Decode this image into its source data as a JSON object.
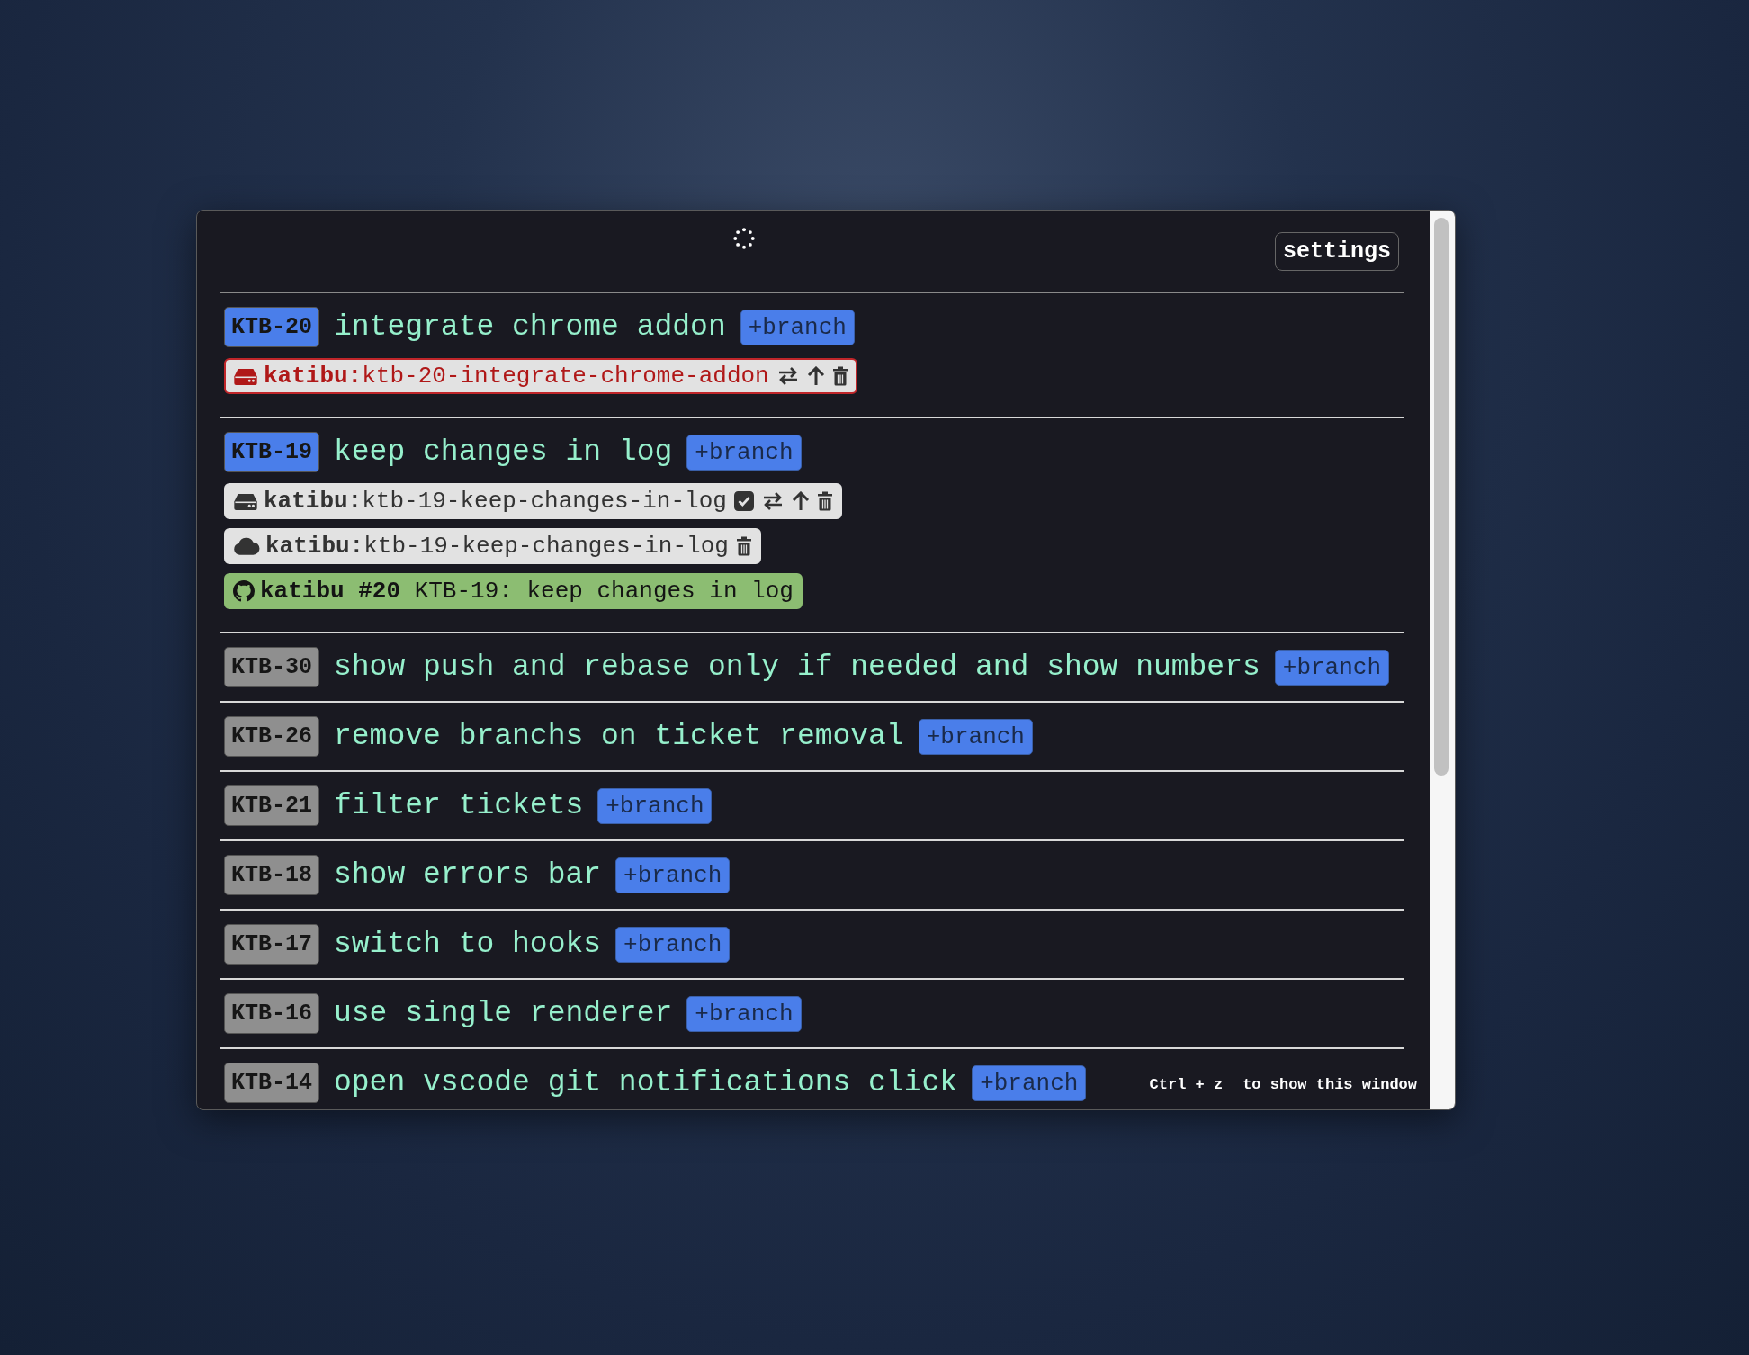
{
  "header": {
    "settings_button": "settings"
  },
  "tickets": [
    {
      "key": "KTB-20",
      "highlighted": true,
      "title": "integrate chrome addon",
      "add_branch": "+branch",
      "branches": [
        {
          "kind": "local",
          "error": true,
          "label": "**katibu:**ktb-20-integrate-chrome-addon",
          "actions": [
            {
              "kind": "switch"
            },
            {
              "kind": "push"
            },
            {
              "kind": "delete"
            }
          ]
        }
      ]
    },
    {
      "key": "KTB-19",
      "highlighted": true,
      "title": "keep changes in log",
      "add_branch": "+branch",
      "branches": [
        {
          "kind": "local",
          "error": false,
          "label": "**katibu:**ktb-19-keep-changes-in-log",
          "actions": [
            {
              "kind": "checkbox",
              "checked": true
            },
            {
              "kind": "switch"
            },
            {
              "kind": "push"
            },
            {
              "kind": "delete"
            }
          ]
        },
        {
          "kind": "remote",
          "error": false,
          "label": "**katibu:**ktb-19-keep-changes-in-log",
          "actions": [
            {
              "kind": "delete"
            }
          ]
        },
        {
          "kind": "pull_request",
          "label": "**katibu #20** KTB-19: keep changes in log"
        }
      ]
    },
    {
      "key": "KTB-30",
      "highlighted": false,
      "title": "show push and rebase only if needed and show numbers",
      "add_branch": "+branch"
    },
    {
      "key": "KTB-26",
      "highlighted": false,
      "title": "remove branchs on ticket removal",
      "add_branch": "+branch"
    },
    {
      "key": "KTB-21",
      "highlighted": false,
      "title": "filter tickets",
      "add_branch": "+branch"
    },
    {
      "key": "KTB-18",
      "highlighted": false,
      "title": "show errors bar",
      "add_branch": "+branch"
    },
    {
      "key": "KTB-17",
      "highlighted": false,
      "title": "switch to hooks",
      "add_branch": "+branch"
    },
    {
      "key": "KTB-16",
      "highlighted": false,
      "title": "use single renderer",
      "add_branch": "+branch"
    },
    {
      "key": "KTB-14",
      "highlighted": false,
      "title": "open vscode git notifications click",
      "add_branch": "+branch"
    }
  ],
  "footer_hint": {
    "shortcut": "Ctrl + z",
    "text": "to show this window"
  }
}
